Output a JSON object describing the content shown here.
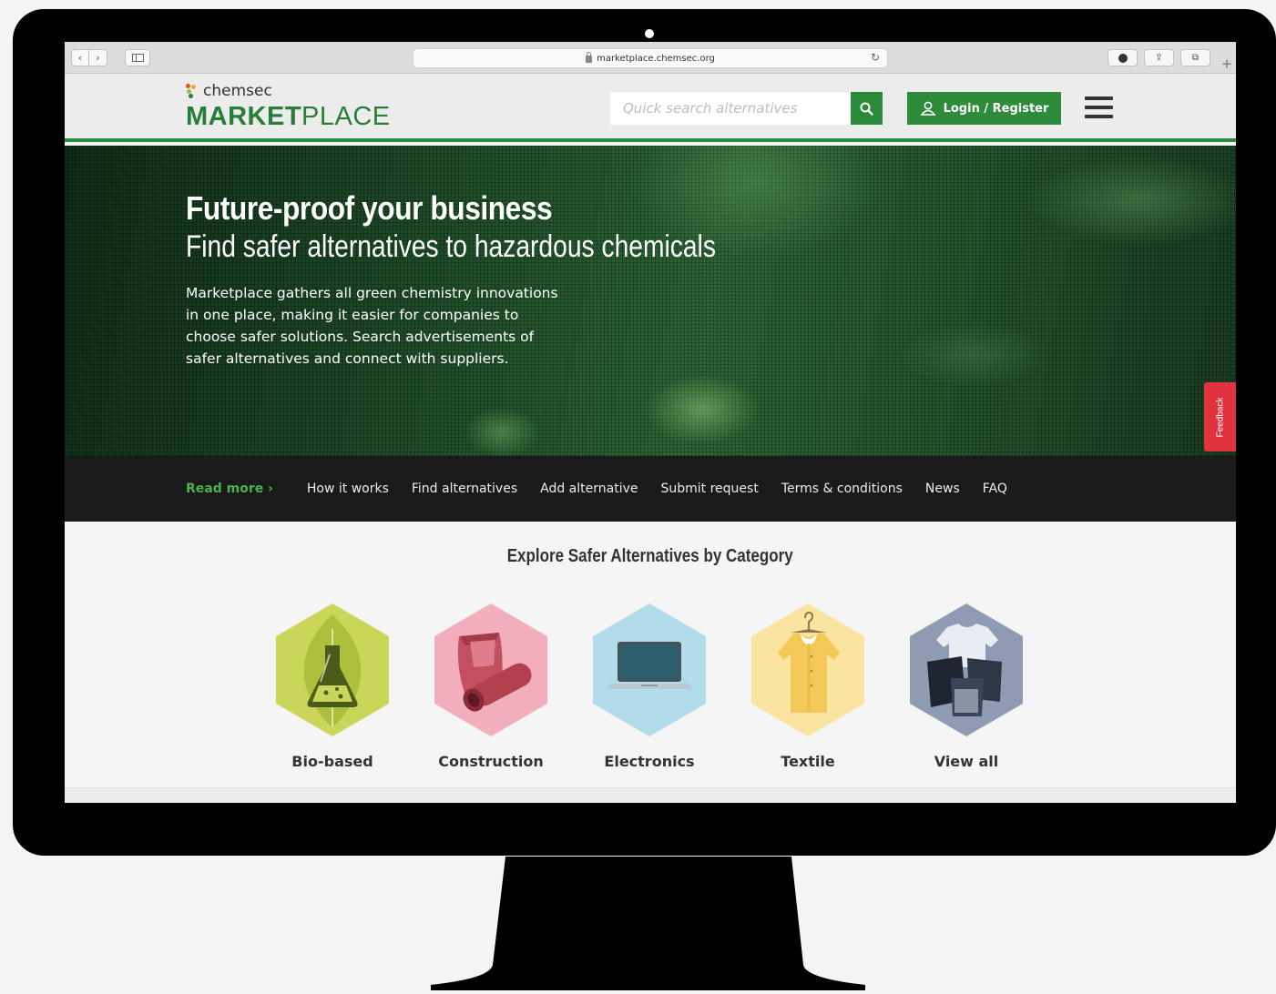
{
  "browser": {
    "url": "marketplace.chemsec.org",
    "back_glyph": "‹",
    "forward_glyph": "›",
    "reload_glyph": "↻",
    "share_glyph": "⇪",
    "tabs_glyph": "⧉",
    "new_tab_glyph": "+"
  },
  "header": {
    "brand_small": "chemsec",
    "brand_bold": "MARKET",
    "brand_light": "PLACE",
    "search_placeholder": "Quick search alternatives",
    "login_label": "Login / Register"
  },
  "hero": {
    "title": "Future-proof your business",
    "subtitle": "Find safer alternatives to hazardous chemicals",
    "body": "Marketplace gathers all green chemistry innovations in one place, making it easier for companies to choose safer solutions. Search advertisements of safer alternatives and connect with suppliers.",
    "feedback_label": "Feedback"
  },
  "subnav": {
    "read_more": "Read more ›",
    "items": [
      "How it works",
      "Find alternatives",
      "Add alternative",
      "Submit request",
      "Terms & conditions",
      "News",
      "FAQ"
    ]
  },
  "categories": {
    "heading": "Explore Safer Alternatives by Category",
    "items": [
      {
        "label": "Bio-based",
        "icon": "flask-leaf-icon",
        "color": "#c9d65a"
      },
      {
        "label": "Construction",
        "icon": "pipe-bag-icon",
        "color": "#f2aebd"
      },
      {
        "label": "Electronics",
        "icon": "laptop-icon",
        "color": "#b3dceb"
      },
      {
        "label": "Textile",
        "icon": "shirt-icon",
        "color": "#fbe3a0"
      },
      {
        "label": "View all",
        "icon": "all-categories-icon",
        "color": "#8f9bb3"
      }
    ]
  },
  "colors": {
    "brand_green": "#2a7d37",
    "feedback_red": "#e0333e",
    "nav_dark": "#1a1a1a"
  }
}
